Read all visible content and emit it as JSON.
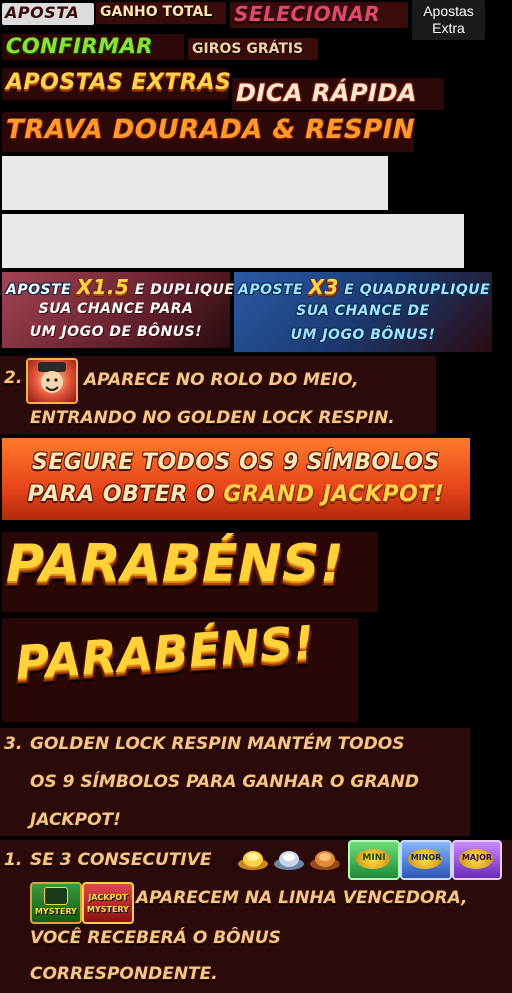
{
  "row1": {
    "aposta": "APOSTA",
    "ganho_total": "GANHO TOTAL",
    "selecionar": "SELECIONAR",
    "apostas_extra": "Apostas Extra"
  },
  "row2": {
    "confirmar": "CONFIRMAR",
    "giros_gratis": "GIROS GRÁTIS"
  },
  "row3": {
    "apostas_extras": "APOSTAS EXTRAS",
    "dica_rapida": "DICA RÁPIDA"
  },
  "row4": {
    "trava": "TRAVA DOURADA & RESPIN"
  },
  "bet_cards": {
    "left": {
      "prefix": "APOSTE",
      "multiplier": "X1.5",
      "suffix": "E DUPLIQUE",
      "line2": "SUA CHANCE PARA",
      "line3": "UM JOGO DE BÔNUS!"
    },
    "right": {
      "prefix": "APOSTE",
      "multiplier": "X3",
      "suffix": "E QUADRUPLIQUE",
      "line2": "SUA CHANCE DE",
      "line3": "UM JOGO BÔNUS!"
    }
  },
  "rule2": {
    "number": "2.",
    "line1": "APARECE NO ROLO DO MEIO,",
    "line2": "ENTRANDO NO GOLDEN LOCK RESPIN."
  },
  "banner": {
    "line1": "SEGURE TODOS OS 9 SÍMBOLOS",
    "line2_prefix": "PARA OBTER O",
    "line2_highlight": "GRAND JACKPOT!"
  },
  "congrats": {
    "big1": "PARABÉNS!",
    "big2": "PARABÉNS!"
  },
  "rule3": {
    "number": "3.",
    "line1": "GOLDEN LOCK RESPIN MANTÉM TODOS",
    "line2": "OS 9 SÍMBOLOS PARA GANHAR O GRAND",
    "line3": "JACKPOT!"
  },
  "rule1": {
    "number": "1.",
    "line1": "SE 3 CONSECUTIVE",
    "line2": "APARECEM NA LINHA VENCEDORA,",
    "line3": "VOCÊ RECEBERÁ O BÔNUS",
    "line4": "CORRESPONDENTE."
  },
  "badges": {
    "mini": "MINI",
    "minor": "MINOR",
    "major": "MAJOR",
    "mystery": "MYSTERY",
    "jackpot_mystery_top": "JACKPOT",
    "jackpot_mystery_bottom": "MYSTERY"
  },
  "colors": {
    "gold": "#ffd44a",
    "orange_banner": "#f0591b",
    "dark_red": "#3a0b0b",
    "blue_card": "#1b3a72",
    "pink_card": "#8a3b4a"
  }
}
